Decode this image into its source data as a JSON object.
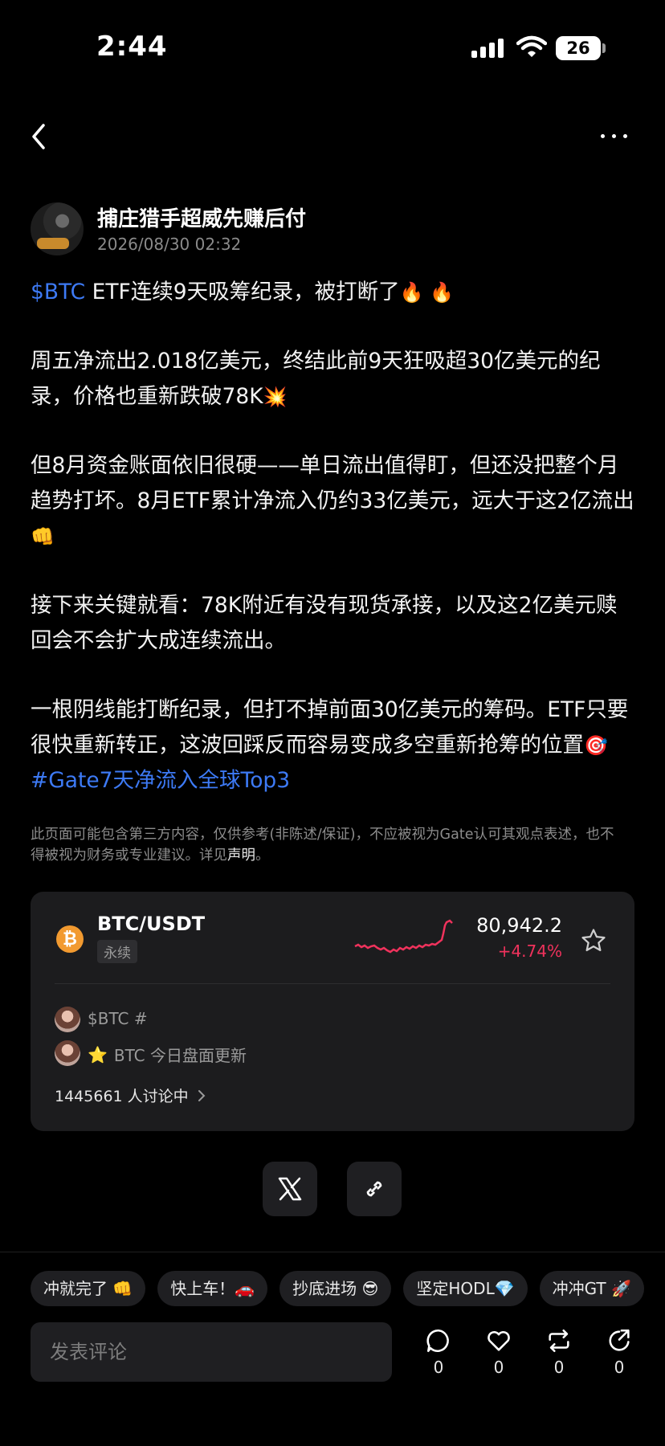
{
  "status_bar": {
    "time": "2:44",
    "battery": "26"
  },
  "author": {
    "name": "捕庄猎手超威先赚后付",
    "time": "2026/08/30 02:32"
  },
  "post": {
    "p1_tag": "$BTC",
    "p1_text": " ETF连续9天吸筹纪录，被打断了",
    "p1_emoji": "🔥 🔥",
    "p2_text": "周五净流出2.018亿美元，终结此前9天狂吸超30亿美元的纪录，价格也重新跌破78K",
    "p2_emoji": "💥",
    "p3_text": "但8月资金账面依旧很硬——单日流出值得盯，但还没把整个月趋势打坏。8月ETF累计净流入仍约33亿美元，远大于这2亿流出",
    "p3_emoji": "👊",
    "p4_text": "接下来关键就看：78K附近有没有现货承接，以及这2亿美元赎回会不会扩大成连续流出。",
    "p5_text": "一根阴线能打断纪录，但打不掉前面30亿美元的筹码。ETF只要很快重新转正，这波回踩反而容易变成多空重新抢筹的位置",
    "p5_emoji": "🎯",
    "p5_hashtag": " #Gate7天净流入全球Top3"
  },
  "disclaimer": {
    "text": "此页面可能包含第三方内容，仅供参考(非陈述/保证)，不应被视为Gate认可其观点表述，也不得被视为财务或专业建议。详见",
    "link": "声明",
    "end": "。"
  },
  "market": {
    "icon": "₿",
    "pair": "BTC/USDT",
    "type": "永续",
    "price": "80,942.2",
    "change": "+4.74%",
    "change_color": "#f0325c",
    "sparkline_color": "#f0325c",
    "topic1": "$BTC #",
    "topic2_icon": "⭐",
    "topic2": "BTC 今日盘面更新",
    "discussion": "1445661 人讨论中"
  },
  "chips": [
    "冲就完了 👊",
    "快上车！🚗",
    "抄底进场 😎",
    "坚定HODL💎",
    "冲冲GT 🚀"
  ],
  "comment": {
    "placeholder": "发表评论"
  },
  "actions": {
    "comments": "0",
    "likes": "0",
    "reposts": "0",
    "shares": "0"
  },
  "colors": {
    "background": "#000000",
    "accent": "#3d7af5",
    "card": "#1c1c1e"
  }
}
